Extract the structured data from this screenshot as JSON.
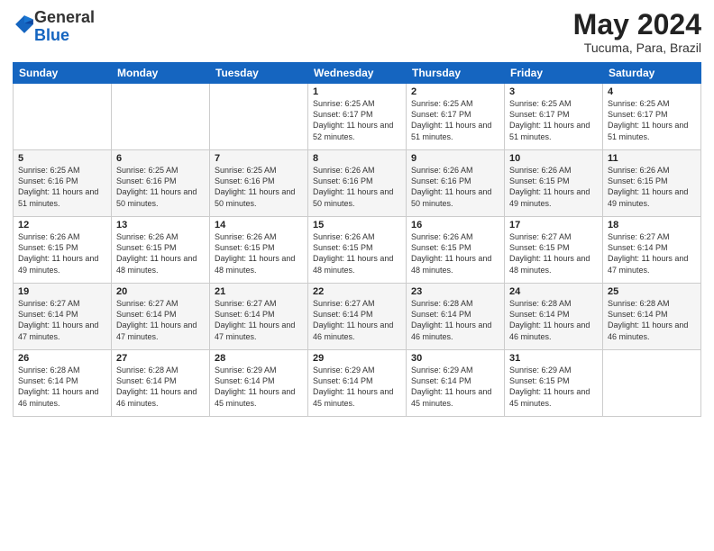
{
  "header": {
    "logo_general": "General",
    "logo_blue": "Blue",
    "title": "May 2024",
    "subtitle": "Tucuma, Para, Brazil"
  },
  "days_of_week": [
    "Sunday",
    "Monday",
    "Tuesday",
    "Wednesday",
    "Thursday",
    "Friday",
    "Saturday"
  ],
  "weeks": [
    [
      {
        "day": "",
        "sunrise": "",
        "sunset": "",
        "daylight": ""
      },
      {
        "day": "",
        "sunrise": "",
        "sunset": "",
        "daylight": ""
      },
      {
        "day": "",
        "sunrise": "",
        "sunset": "",
        "daylight": ""
      },
      {
        "day": "1",
        "sunrise": "6:25 AM",
        "sunset": "6:17 PM",
        "daylight": "11 hours and 52 minutes."
      },
      {
        "day": "2",
        "sunrise": "6:25 AM",
        "sunset": "6:17 PM",
        "daylight": "11 hours and 51 minutes."
      },
      {
        "day": "3",
        "sunrise": "6:25 AM",
        "sunset": "6:17 PM",
        "daylight": "11 hours and 51 minutes."
      },
      {
        "day": "4",
        "sunrise": "6:25 AM",
        "sunset": "6:17 PM",
        "daylight": "11 hours and 51 minutes."
      }
    ],
    [
      {
        "day": "5",
        "sunrise": "6:25 AM",
        "sunset": "6:16 PM",
        "daylight": "11 hours and 51 minutes."
      },
      {
        "day": "6",
        "sunrise": "6:25 AM",
        "sunset": "6:16 PM",
        "daylight": "11 hours and 50 minutes."
      },
      {
        "day": "7",
        "sunrise": "6:25 AM",
        "sunset": "6:16 PM",
        "daylight": "11 hours and 50 minutes."
      },
      {
        "day": "8",
        "sunrise": "6:26 AM",
        "sunset": "6:16 PM",
        "daylight": "11 hours and 50 minutes."
      },
      {
        "day": "9",
        "sunrise": "6:26 AM",
        "sunset": "6:16 PM",
        "daylight": "11 hours and 50 minutes."
      },
      {
        "day": "10",
        "sunrise": "6:26 AM",
        "sunset": "6:15 PM",
        "daylight": "11 hours and 49 minutes."
      },
      {
        "day": "11",
        "sunrise": "6:26 AM",
        "sunset": "6:15 PM",
        "daylight": "11 hours and 49 minutes."
      }
    ],
    [
      {
        "day": "12",
        "sunrise": "6:26 AM",
        "sunset": "6:15 PM",
        "daylight": "11 hours and 49 minutes."
      },
      {
        "day": "13",
        "sunrise": "6:26 AM",
        "sunset": "6:15 PM",
        "daylight": "11 hours and 48 minutes."
      },
      {
        "day": "14",
        "sunrise": "6:26 AM",
        "sunset": "6:15 PM",
        "daylight": "11 hours and 48 minutes."
      },
      {
        "day": "15",
        "sunrise": "6:26 AM",
        "sunset": "6:15 PM",
        "daylight": "11 hours and 48 minutes."
      },
      {
        "day": "16",
        "sunrise": "6:26 AM",
        "sunset": "6:15 PM",
        "daylight": "11 hours and 48 minutes."
      },
      {
        "day": "17",
        "sunrise": "6:27 AM",
        "sunset": "6:15 PM",
        "daylight": "11 hours and 48 minutes."
      },
      {
        "day": "18",
        "sunrise": "6:27 AM",
        "sunset": "6:14 PM",
        "daylight": "11 hours and 47 minutes."
      }
    ],
    [
      {
        "day": "19",
        "sunrise": "6:27 AM",
        "sunset": "6:14 PM",
        "daylight": "11 hours and 47 minutes."
      },
      {
        "day": "20",
        "sunrise": "6:27 AM",
        "sunset": "6:14 PM",
        "daylight": "11 hours and 47 minutes."
      },
      {
        "day": "21",
        "sunrise": "6:27 AM",
        "sunset": "6:14 PM",
        "daylight": "11 hours and 47 minutes."
      },
      {
        "day": "22",
        "sunrise": "6:27 AM",
        "sunset": "6:14 PM",
        "daylight": "11 hours and 46 minutes."
      },
      {
        "day": "23",
        "sunrise": "6:28 AM",
        "sunset": "6:14 PM",
        "daylight": "11 hours and 46 minutes."
      },
      {
        "day": "24",
        "sunrise": "6:28 AM",
        "sunset": "6:14 PM",
        "daylight": "11 hours and 46 minutes."
      },
      {
        "day": "25",
        "sunrise": "6:28 AM",
        "sunset": "6:14 PM",
        "daylight": "11 hours and 46 minutes."
      }
    ],
    [
      {
        "day": "26",
        "sunrise": "6:28 AM",
        "sunset": "6:14 PM",
        "daylight": "11 hours and 46 minutes."
      },
      {
        "day": "27",
        "sunrise": "6:28 AM",
        "sunset": "6:14 PM",
        "daylight": "11 hours and 46 minutes."
      },
      {
        "day": "28",
        "sunrise": "6:29 AM",
        "sunset": "6:14 PM",
        "daylight": "11 hours and 45 minutes."
      },
      {
        "day": "29",
        "sunrise": "6:29 AM",
        "sunset": "6:14 PM",
        "daylight": "11 hours and 45 minutes."
      },
      {
        "day": "30",
        "sunrise": "6:29 AM",
        "sunset": "6:14 PM",
        "daylight": "11 hours and 45 minutes."
      },
      {
        "day": "31",
        "sunrise": "6:29 AM",
        "sunset": "6:15 PM",
        "daylight": "11 hours and 45 minutes."
      },
      {
        "day": "",
        "sunrise": "",
        "sunset": "",
        "daylight": ""
      }
    ]
  ],
  "labels": {
    "sunrise": "Sunrise:",
    "sunset": "Sunset:",
    "daylight": "Daylight:"
  }
}
